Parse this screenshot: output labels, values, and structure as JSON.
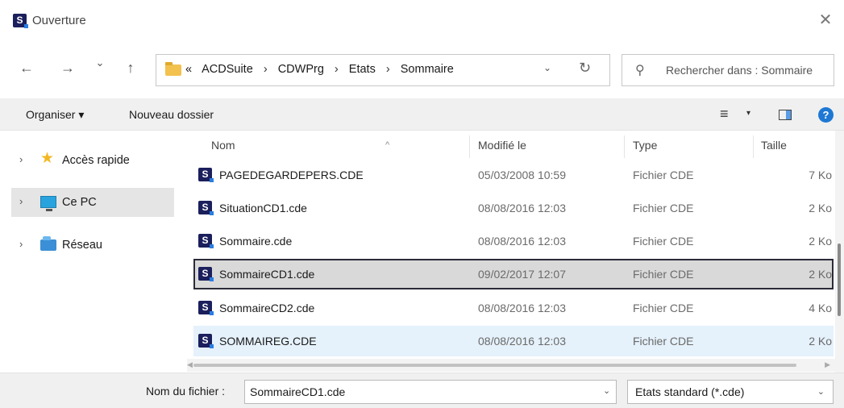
{
  "window": {
    "title": "Ouverture",
    "app_icon_letter": "S",
    "close_glyph": "✕"
  },
  "nav": {
    "back_glyph": "←",
    "forward_glyph": "→",
    "recent_glyph": "⌄",
    "up_glyph": "↑",
    "breadcrumb": {
      "overflow": "«",
      "items": [
        "ACDSuite",
        "CDWPrg",
        "Etats",
        "Sommaire"
      ],
      "separator": "›"
    },
    "dropdown_glyph": "⌄",
    "refresh_glyph": "↻",
    "search": {
      "icon_glyph": "⚲",
      "placeholder": "Rechercher dans : Sommaire"
    }
  },
  "toolbar": {
    "organize": "Organiser ▾",
    "new_folder": "Nouveau dossier",
    "view_glyph": "≡",
    "view_caret": "▾",
    "help_glyph": "?"
  },
  "sidebar": {
    "expand_glyph": "›",
    "items": [
      {
        "label": "Accès rapide",
        "icon": "star-icon"
      },
      {
        "label": "Ce PC",
        "icon": "computer-icon",
        "selected": true
      },
      {
        "label": "Réseau",
        "icon": "network-icon"
      }
    ]
  },
  "filelist": {
    "sort_glyph": "^",
    "columns": {
      "name": "Nom",
      "modified": "Modifié le",
      "type": "Type",
      "size": "Taille"
    },
    "file_icon_letter": "S",
    "rows": [
      {
        "name": "PAGEDEGARDEPERS.CDE",
        "modified": "05/03/2008 10:59",
        "type": "Fichier CDE",
        "size": "7 Ko"
      },
      {
        "name": "SituationCD1.cde",
        "modified": "08/08/2016 12:03",
        "type": "Fichier CDE",
        "size": "2 Ko"
      },
      {
        "name": "Sommaire.cde",
        "modified": "08/08/2016 12:03",
        "type": "Fichier CDE",
        "size": "2 Ko"
      },
      {
        "name": "SommaireCD1.cde",
        "modified": "09/02/2017 12:07",
        "type": "Fichier CDE",
        "size": "2 Ko",
        "state": "selected"
      },
      {
        "name": "SommaireCD2.cde",
        "modified": "08/08/2016 12:03",
        "type": "Fichier CDE",
        "size": "4 Ko"
      },
      {
        "name": "SOMMAIREG.CDE",
        "modified": "08/08/2016 12:03",
        "type": "Fichier CDE",
        "size": "2 Ko",
        "state": "hover"
      }
    ]
  },
  "footer": {
    "filename_label": "Nom du fichier :",
    "filename_value": "SommaireCD1.cde",
    "dropdown_glyph": "⌄",
    "filetype_value": "Etats standard (*.cde)"
  },
  "scroll": {
    "left_glyph": "◀",
    "right_glyph": "▶"
  }
}
